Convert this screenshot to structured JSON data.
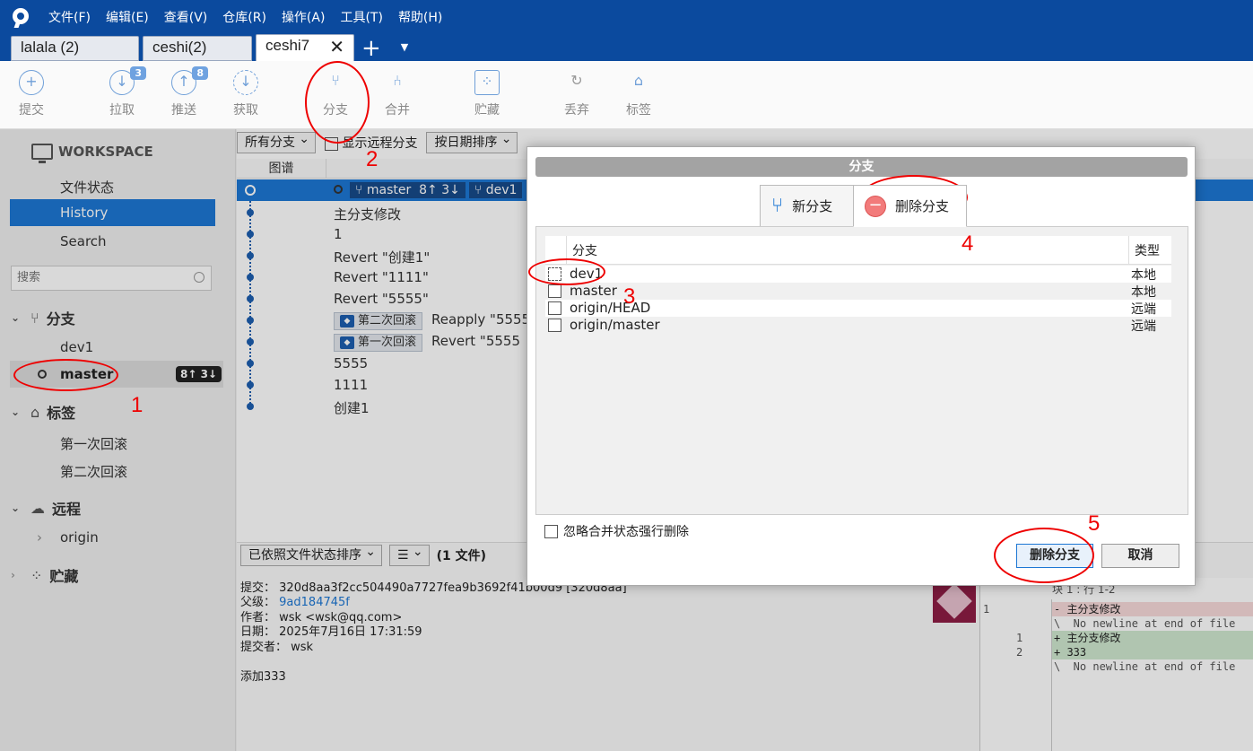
{
  "menu": {
    "items": [
      "文件(F)",
      "编辑(E)",
      "查看(V)",
      "仓库(R)",
      "操作(A)",
      "工具(T)",
      "帮助(H)"
    ]
  },
  "tabs": [
    {
      "label": "lalala (2)"
    },
    {
      "label": "ceshi(2)"
    },
    {
      "label": "ceshi7",
      "close": "✕"
    }
  ],
  "toolbar": {
    "commit": "提交",
    "pull": "拉取",
    "pull_badge": "3",
    "push": "推送",
    "push_badge": "8",
    "fetch": "获取",
    "branch": "分支",
    "merge": "合并",
    "stash": "贮藏",
    "discard": "丢弃",
    "tag": "标签"
  },
  "sidebar": {
    "workspace": "WORKSPACE",
    "file_status": "文件状态",
    "history": "History",
    "search": "Search",
    "search_placeholder": "搜索",
    "branches_title": "分支",
    "branch_dev1": "dev1",
    "branch_master": "master",
    "master_ab": "8↑ 3↓",
    "tags_title": "标签",
    "tag1": "第一次回滚",
    "tag2": "第二次回滚",
    "remote_title": "远程",
    "remote_origin": "origin",
    "stash_title": "贮藏"
  },
  "filters": {
    "branch_filter": "所有分支",
    "show_remote": "显示远程分支",
    "sort": "按日期排序"
  },
  "log": {
    "graph_header": "图谱",
    "head_branch": "master",
    "head_ab": "8↑ 3↓",
    "head_branch2": "dev1",
    "rows": [
      "主分支修改",
      "1",
      "Revert \"创建1\"",
      "Revert \"1111\"",
      "Revert \"5555\"",
      "Reapply \"5555",
      "Revert \"5555",
      "5555",
      "1111",
      "创建1"
    ],
    "tag_second": "第二次回滚",
    "tag_first": "第一次回滚"
  },
  "bottom": {
    "sort": "已依照文件状态排序",
    "files": "(1 文件)",
    "commit_label": "提交：",
    "commit_val": "320d8aa3f2cc504490a7727fea9b3692f41b00d9 [320d8aa]",
    "parent_label": "父级：",
    "parent_val": "9ad184745f",
    "author_label": "作者：",
    "author_val": "wsk <wsk@qq.com>",
    "date_label": "日期：",
    "date_val": "2025年7月16日 17:31:59",
    "committer_label": "提交者：",
    "committer_val": "wsk",
    "message": "添加333",
    "hunk": "块 1 : 行 1-2",
    "diff": [
      "- 主分支修改",
      "\\  No newline at end of file",
      "+ 主分支修改",
      "+ 333",
      "\\  No newline at end of file"
    ],
    "diff_old": "1",
    "diff_new1": "1",
    "diff_new2": "2"
  },
  "dialog": {
    "title": "分支",
    "tab_new": "新分支",
    "tab_delete": "删除分支",
    "col_branch": "分支",
    "col_type": "类型",
    "rows": [
      {
        "name": "dev1",
        "type": "本地"
      },
      {
        "name": "master",
        "type": "本地"
      },
      {
        "name": "origin/HEAD",
        "type": "远端"
      },
      {
        "name": "origin/master",
        "type": "远端"
      }
    ],
    "force": "忽略合并状态强行删除",
    "delete_btn": "删除分支",
    "cancel_btn": "取消"
  },
  "annotations": [
    "1",
    "2",
    "3",
    "4",
    "5"
  ],
  "colors": {
    "titlebar": "#0b4a9e",
    "accent": "#1d77d4",
    "annotation": "#e00000"
  }
}
